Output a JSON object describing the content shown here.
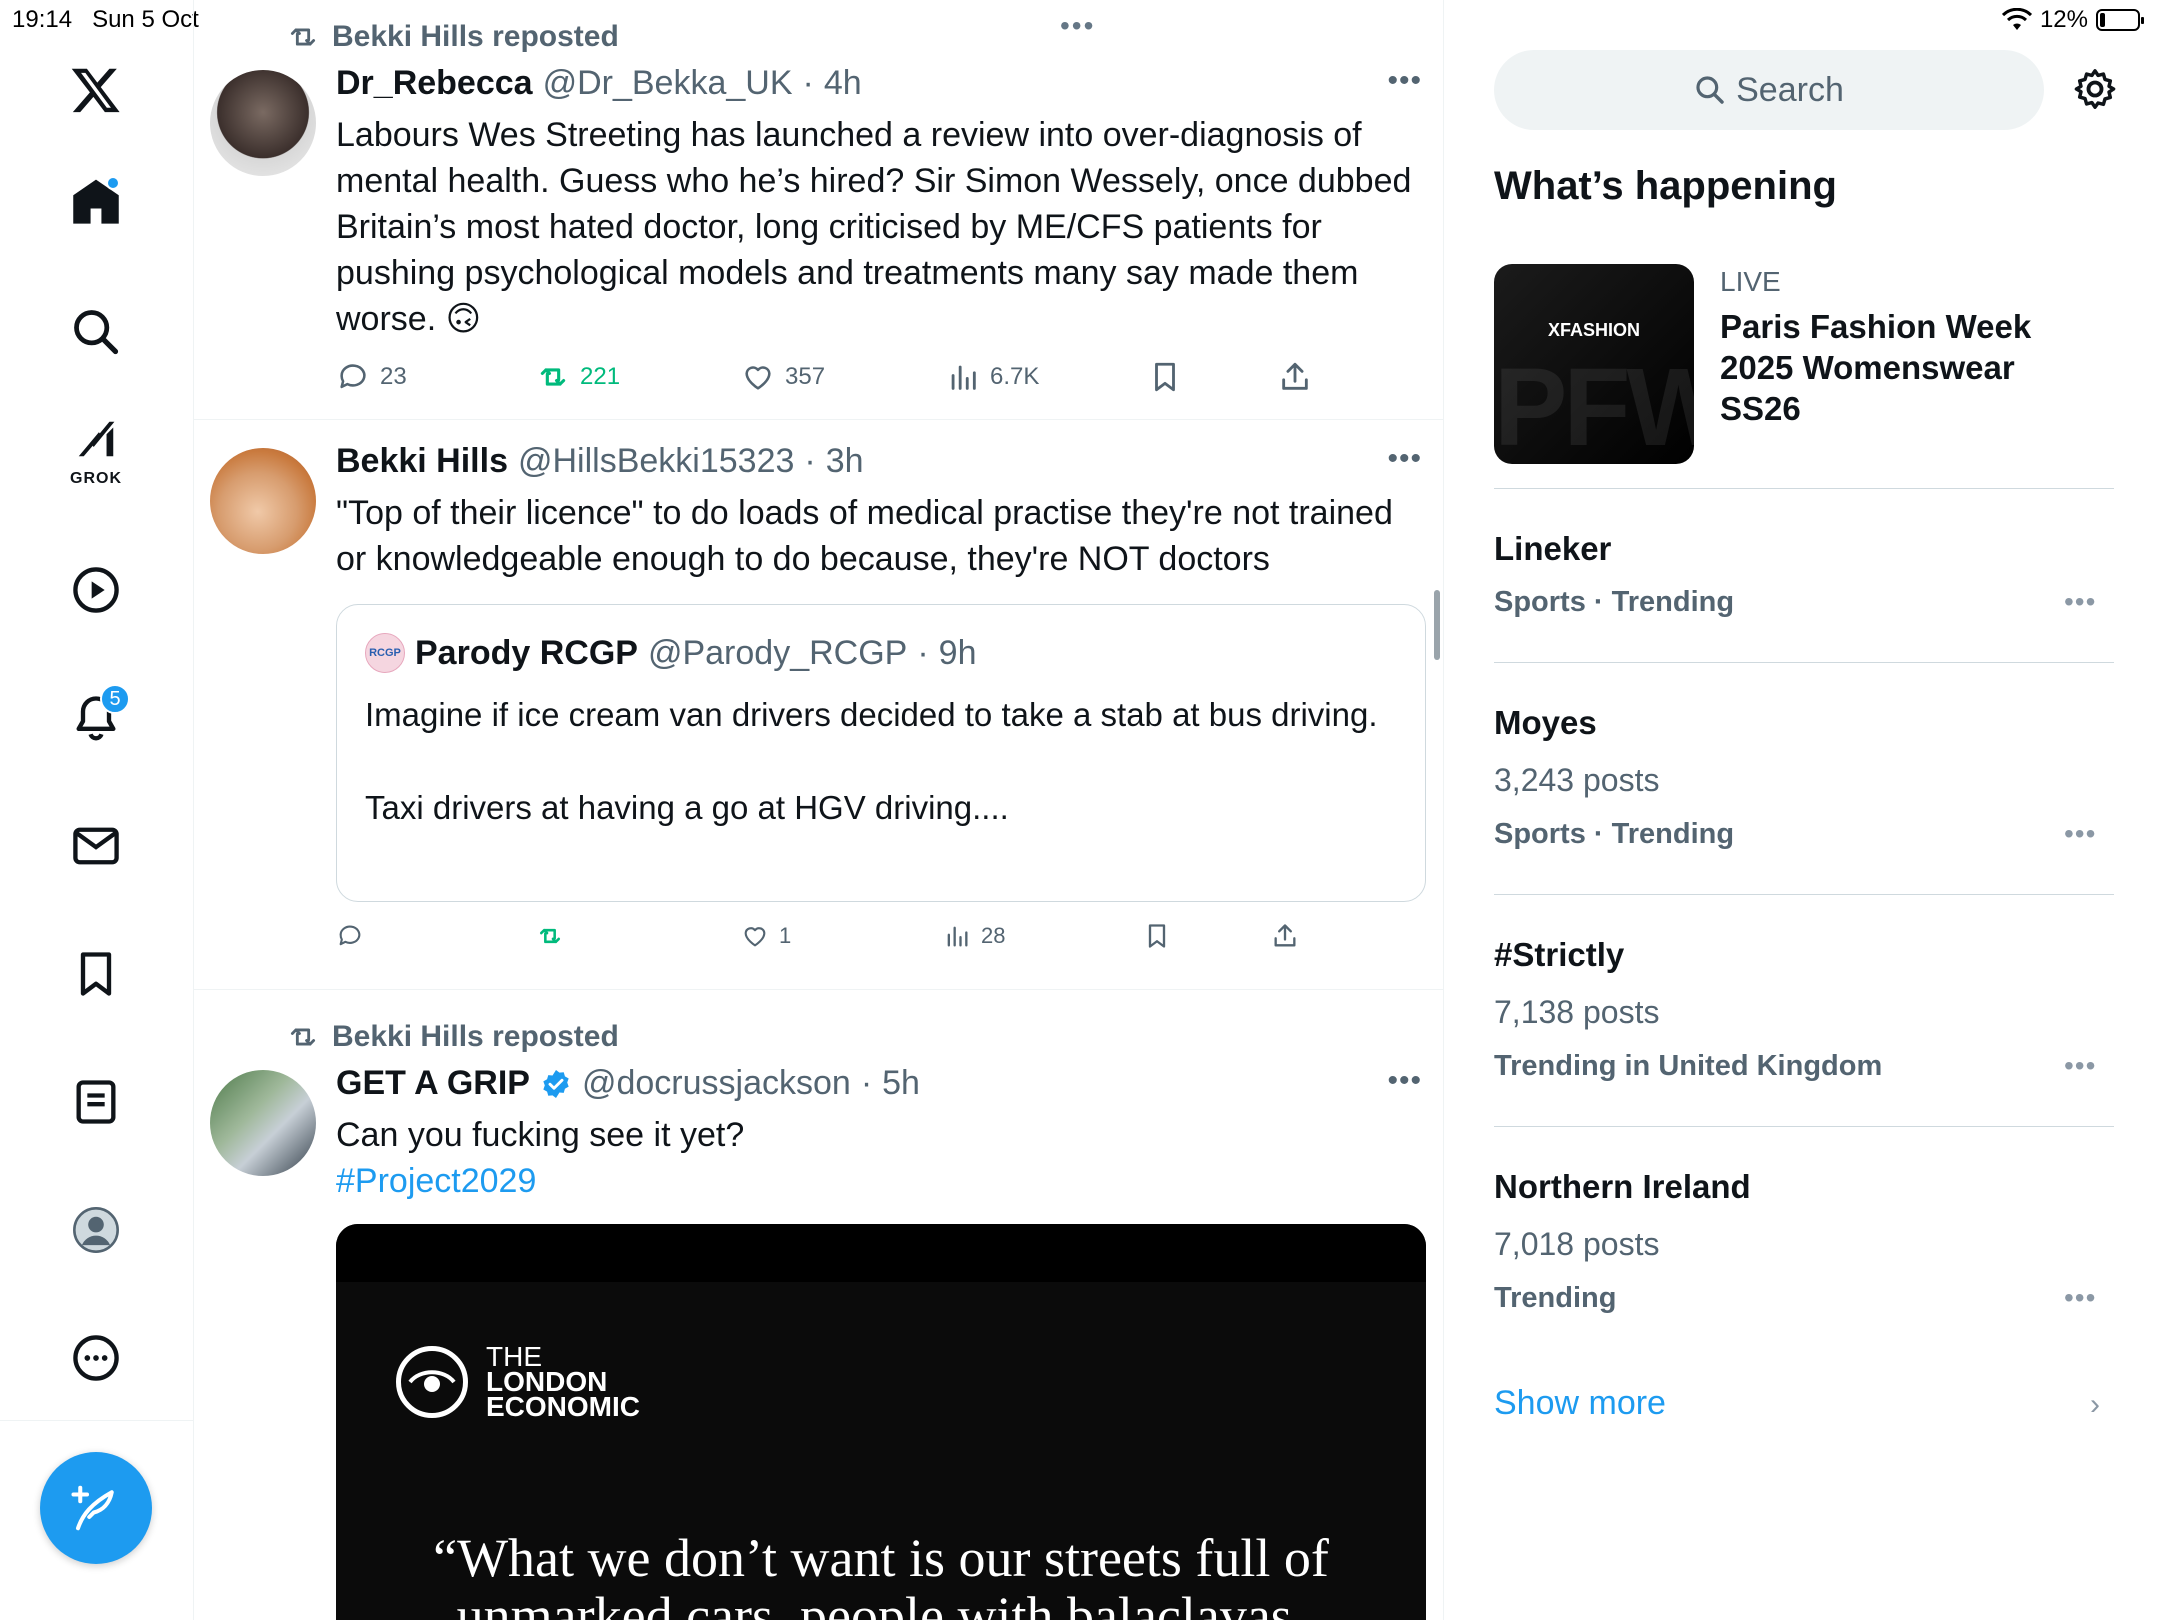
{
  "status_bar": {
    "time": "19:14",
    "date": "Sun 5 Oct",
    "battery": "12%"
  },
  "sidebar": {
    "grok_label": "GROK",
    "notifications_badge": "5"
  },
  "posts": [
    {
      "repost_by": "Bekki Hills reposted",
      "name": "Dr_Rebecca",
      "handle": "@Dr_Bekka_UK",
      "time": "4h",
      "text": "Labours Wes Streeting has launched a review into over-diagnosis of mental health. Guess who he’s hired? Sir Simon Wessely, once dubbed Britain’s most hated doctor, long criticised by ME/CFS patients for pushing psychological models and treatments many say made them worse. 🙃",
      "replies": "23",
      "reposts": "221",
      "likes": "357",
      "views": "6.7K"
    },
    {
      "name": "Bekki Hills",
      "handle": "@HillsBekki15323",
      "time": "3h",
      "text": "\"Top of their licence\" to do loads of medical practise they're not trained or knowledgeable enough to do because, they're NOT doctors",
      "quote": {
        "avatar_text": "RCGP",
        "name": "Parody RCGP",
        "handle": "@Parody_RCGP",
        "time": "9h",
        "text_line1": "Imagine if ice cream van drivers decided to take a stab at bus driving.",
        "text_line2": "Taxi drivers at having a go at HGV driving...."
      },
      "likes": "1",
      "views": "28"
    },
    {
      "repost_by": "Bekki Hills reposted",
      "name": "GET A GRIP",
      "handle": "@docrussjackson",
      "time": "5h",
      "text": "Can you fucking see it yet?",
      "hashtag": "#Project2029",
      "media": {
        "logo_line1": "THE",
        "logo_line2": "LONDON",
        "logo_line3": "ECONOMIC",
        "quote_line1": "“What we don’t want is our streets full of",
        "quote_line2": "unmarked cars, people with balaclavas,"
      }
    }
  ],
  "right": {
    "search_placeholder": "Search",
    "section_title": "What’s happening",
    "live": {
      "image_text": "XFASHION",
      "image_watermark": "PFW",
      "label": "LIVE",
      "title": "Paris Fashion Week 2025 Womenswear SS26"
    },
    "trends": [
      {
        "title": "Lineker",
        "posts": "",
        "category": "Sports · Trending"
      },
      {
        "title": "Moyes",
        "posts": "3,243 posts",
        "category": "Sports · Trending"
      },
      {
        "title": "#Strictly",
        "posts": "7,138 posts",
        "category": "Trending in United Kingdom"
      },
      {
        "title": "Northern Ireland",
        "posts": "7,018 posts",
        "category": "Trending"
      }
    ],
    "show_more": "Show more"
  },
  "colors": {
    "accent": "#1d9bf0",
    "repost_green": "#00ba7c",
    "muted": "#536471"
  }
}
